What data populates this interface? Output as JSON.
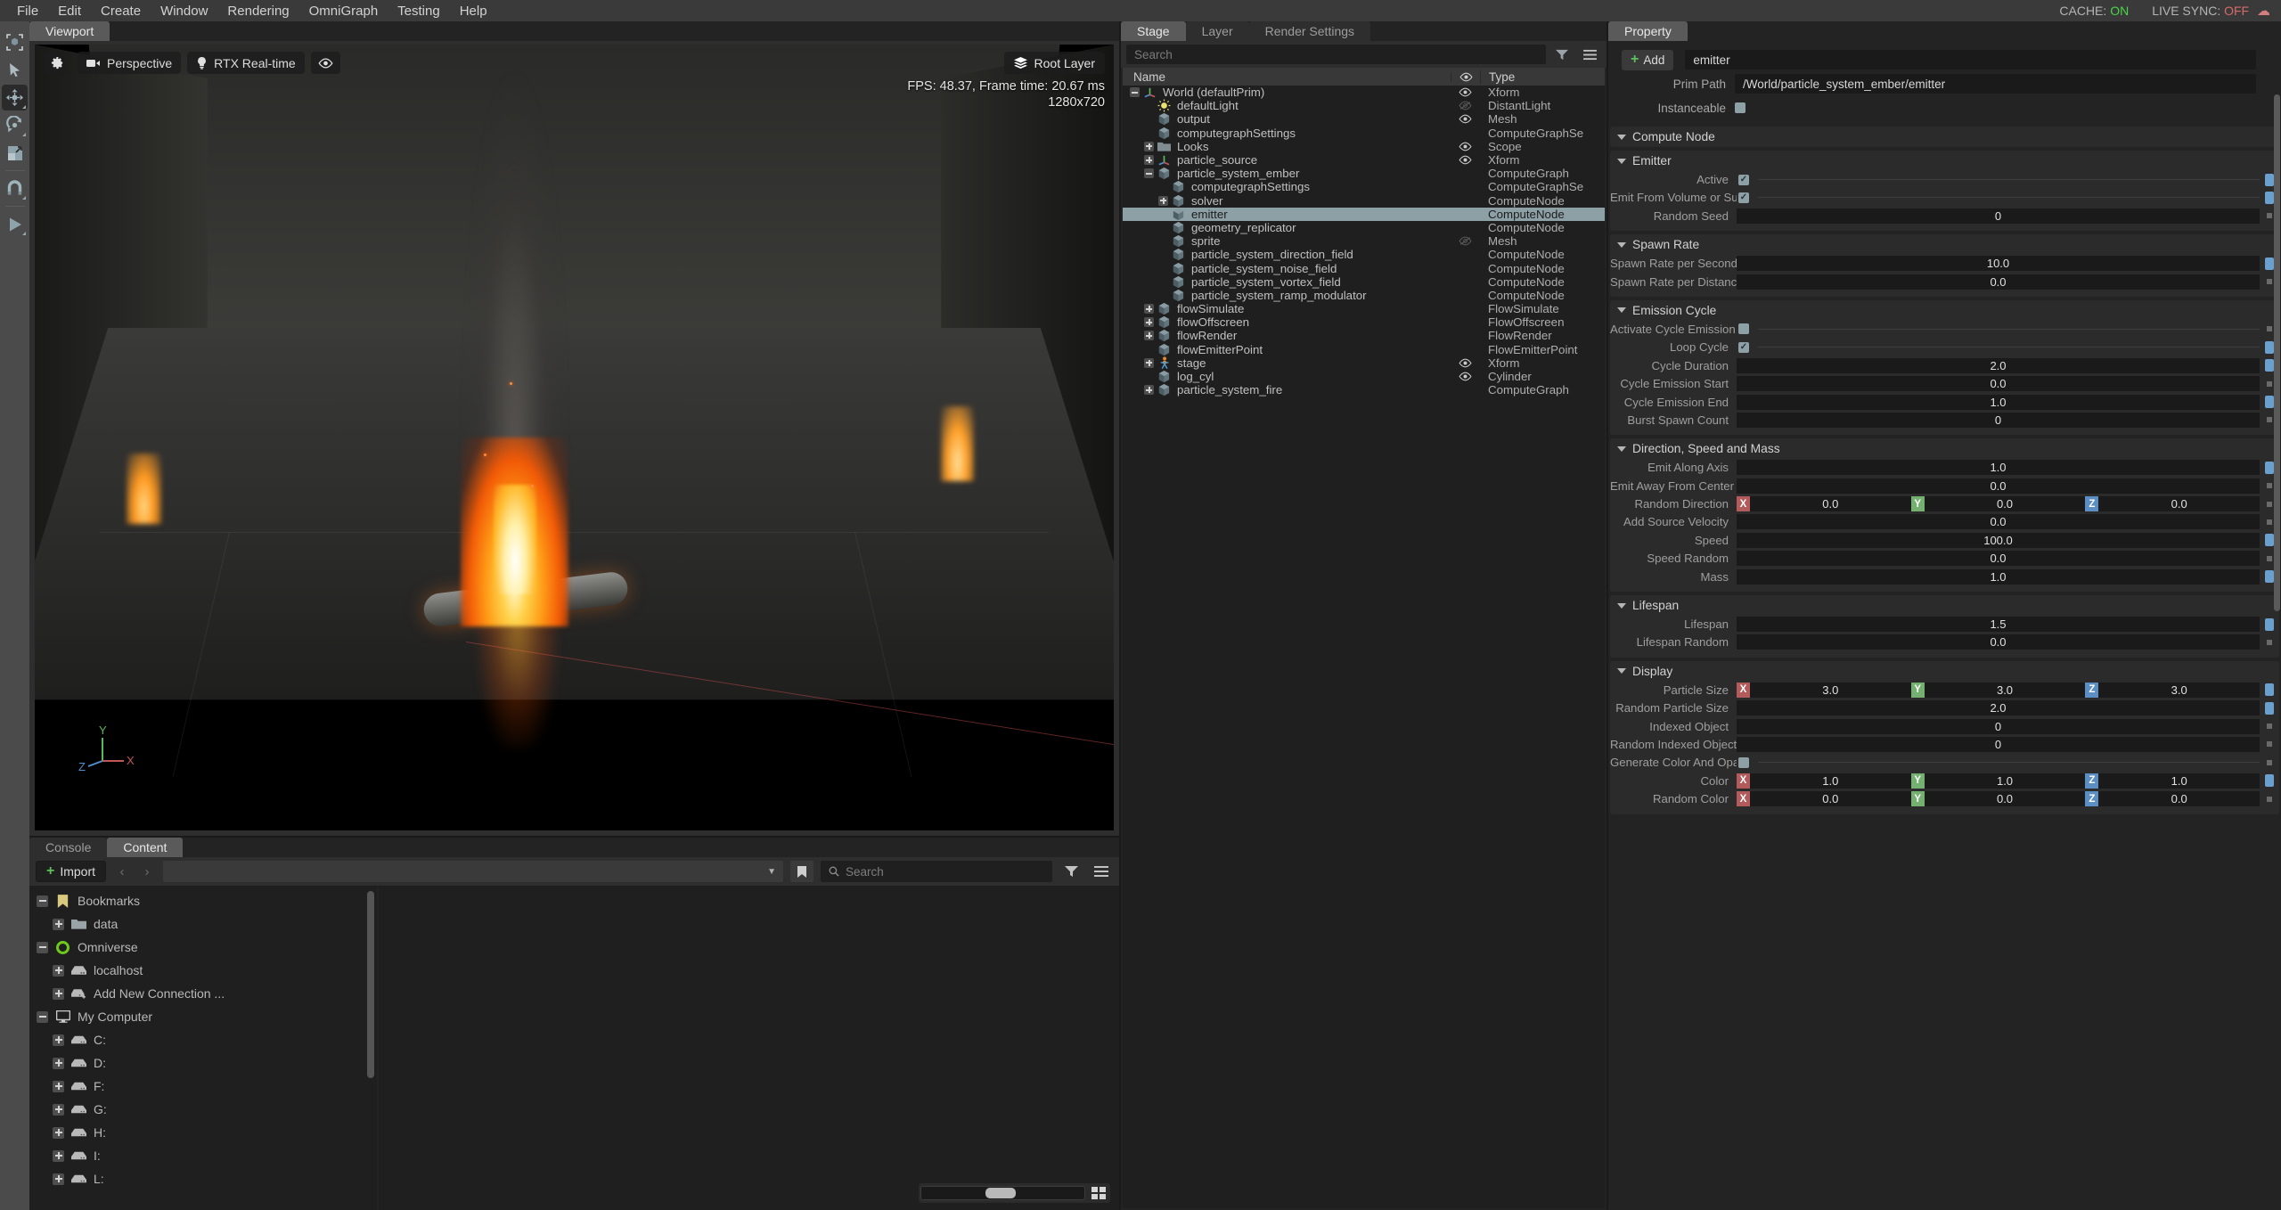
{
  "menu": {
    "items": [
      "File",
      "Edit",
      "Create",
      "Window",
      "Rendering",
      "OmniGraph",
      "Testing",
      "Help"
    ],
    "cache_label": "CACHE:",
    "cache_value": "ON",
    "livesync_label": "LIVE SYNC:",
    "livesync_value": "OFF"
  },
  "viewport": {
    "tab": "Viewport",
    "settings_button": "settings",
    "camera_label": "Perspective",
    "renderer_label": "RTX Real-time",
    "visibility_button": "visibility",
    "root_layer": "Root Layer",
    "fps_text": "FPS: 48.37, Frame time: 20.67 ms",
    "resolution": "1280x720",
    "axis": {
      "x": "X",
      "y": "Y",
      "z": "Z"
    }
  },
  "toolbar": {
    "tools": [
      {
        "name": "select-box-tool",
        "label": "Select Box",
        "active": false
      },
      {
        "name": "select-tool",
        "label": "Select",
        "active": false
      },
      {
        "name": "move-tool",
        "label": "Move",
        "active": true
      },
      {
        "name": "rotate-tool",
        "label": "Rotate",
        "active": false
      },
      {
        "name": "scale-tool",
        "label": "Scale",
        "active": false
      },
      {
        "name": "snap-tool",
        "label": "Snap",
        "active": false
      },
      {
        "name": "play-tool",
        "label": "Play",
        "active": false
      }
    ]
  },
  "bottom": {
    "tabs": [
      {
        "label": "Console",
        "active": false
      },
      {
        "label": "Content",
        "active": true
      }
    ],
    "import_label": "Import",
    "path_value": "",
    "search_placeholder": "Search",
    "tree": [
      {
        "label": "Bookmarks",
        "indent": 0,
        "expander": "minus",
        "icon": "bookmark-icon"
      },
      {
        "label": "data",
        "indent": 1,
        "expander": "plus",
        "icon": "folder-icon"
      },
      {
        "label": "Omniverse",
        "indent": 0,
        "expander": "minus",
        "icon": "omniverse-icon"
      },
      {
        "label": "localhost",
        "indent": 1,
        "expander": "plus",
        "icon": "server-icon"
      },
      {
        "label": "Add New Connection ...",
        "indent": 1,
        "expander": "plus",
        "icon": "server-add-icon"
      },
      {
        "label": "My Computer",
        "indent": 0,
        "expander": "minus",
        "icon": "computer-icon"
      },
      {
        "label": "C:",
        "indent": 1,
        "expander": "plus",
        "icon": "drive-icon"
      },
      {
        "label": "D:",
        "indent": 1,
        "expander": "plus",
        "icon": "drive-icon"
      },
      {
        "label": "F:",
        "indent": 1,
        "expander": "plus",
        "icon": "drive-icon"
      },
      {
        "label": "G:",
        "indent": 1,
        "expander": "plus",
        "icon": "drive-icon"
      },
      {
        "label": "H:",
        "indent": 1,
        "expander": "plus",
        "icon": "drive-icon"
      },
      {
        "label": "I:",
        "indent": 1,
        "expander": "plus",
        "icon": "drive-icon"
      },
      {
        "label": "L:",
        "indent": 1,
        "expander": "plus",
        "icon": "drive-icon"
      }
    ]
  },
  "stage": {
    "tabs": [
      {
        "label": "Stage",
        "active": true
      },
      {
        "label": "Layer",
        "active": false
      },
      {
        "label": "Render Settings",
        "active": false
      }
    ],
    "search_placeholder": "Search",
    "columns": {
      "name": "Name",
      "type": "Type"
    },
    "rows": [
      {
        "label": "World (defaultPrim)",
        "type": "Xform",
        "indent": 0,
        "expander": "minus",
        "icon": "axis-icon",
        "eye": "visible",
        "selected": false
      },
      {
        "label": "defaultLight",
        "type": "DistantLight",
        "indent": 1,
        "expander": "none",
        "icon": "light-icon",
        "eye": "hidden",
        "selected": false
      },
      {
        "label": "output",
        "type": "Mesh",
        "indent": 1,
        "expander": "none",
        "icon": "cube-icon",
        "eye": "visible",
        "selected": false
      },
      {
        "label": "computegraphSettings",
        "type": "ComputeGraphSe",
        "indent": 1,
        "expander": "none",
        "icon": "cube-icon",
        "eye": "none",
        "selected": false
      },
      {
        "label": "Looks",
        "type": "Scope",
        "indent": 1,
        "expander": "plus",
        "icon": "folder-icon",
        "eye": "visible",
        "selected": false
      },
      {
        "label": "particle_source",
        "type": "Xform",
        "indent": 1,
        "expander": "plus",
        "icon": "axis-icon",
        "eye": "visible",
        "selected": false
      },
      {
        "label": "particle_system_ember",
        "type": "ComputeGraph",
        "indent": 1,
        "expander": "minus",
        "icon": "cube-icon",
        "eye": "none",
        "selected": false
      },
      {
        "label": "computegraphSettings",
        "type": "ComputeGraphSe",
        "indent": 2,
        "expander": "none",
        "icon": "cube-icon",
        "eye": "none",
        "selected": false
      },
      {
        "label": "solver",
        "type": "ComputeNode",
        "indent": 2,
        "expander": "plus",
        "icon": "cube-icon",
        "eye": "none",
        "selected": false
      },
      {
        "label": "emitter",
        "type": "ComputeNode",
        "indent": 2,
        "expander": "none",
        "icon": "cube-icon",
        "eye": "none",
        "selected": true
      },
      {
        "label": "geometry_replicator",
        "type": "ComputeNode",
        "indent": 2,
        "expander": "none",
        "icon": "cube-icon",
        "eye": "none",
        "selected": false
      },
      {
        "label": "sprite",
        "type": "Mesh",
        "indent": 2,
        "expander": "none",
        "icon": "cube-icon",
        "eye": "hidden",
        "selected": false
      },
      {
        "label": "particle_system_direction_field",
        "type": "ComputeNode",
        "indent": 2,
        "expander": "none",
        "icon": "cube-icon",
        "eye": "none",
        "selected": false
      },
      {
        "label": "particle_system_noise_field",
        "type": "ComputeNode",
        "indent": 2,
        "expander": "none",
        "icon": "cube-icon",
        "eye": "none",
        "selected": false
      },
      {
        "label": "particle_system_vortex_field",
        "type": "ComputeNode",
        "indent": 2,
        "expander": "none",
        "icon": "cube-icon",
        "eye": "none",
        "selected": false
      },
      {
        "label": "particle_system_ramp_modulator",
        "type": "ComputeNode",
        "indent": 2,
        "expander": "none",
        "icon": "cube-icon",
        "eye": "none",
        "selected": false
      },
      {
        "label": "flowSimulate",
        "type": "FlowSimulate",
        "indent": 1,
        "expander": "plus",
        "icon": "cube-icon",
        "eye": "none",
        "selected": false
      },
      {
        "label": "flowOffscreen",
        "type": "FlowOffscreen",
        "indent": 1,
        "expander": "plus",
        "icon": "cube-icon",
        "eye": "none",
        "selected": false
      },
      {
        "label": "flowRender",
        "type": "FlowRender",
        "indent": 1,
        "expander": "plus",
        "icon": "cube-icon",
        "eye": "none",
        "selected": false
      },
      {
        "label": "flowEmitterPoint",
        "type": "FlowEmitterPoint",
        "indent": 1,
        "expander": "none",
        "icon": "cube-icon",
        "eye": "none",
        "selected": false
      },
      {
        "label": "stage",
        "type": "Xform",
        "indent": 1,
        "expander": "plus",
        "icon": "person-icon",
        "eye": "visible",
        "selected": false
      },
      {
        "label": "log_cyl",
        "type": "Cylinder",
        "indent": 1,
        "expander": "none",
        "icon": "cube-icon",
        "eye": "visible",
        "selected": false
      },
      {
        "label": "particle_system_fire",
        "type": "ComputeGraph",
        "indent": 1,
        "expander": "plus",
        "icon": "cube-icon",
        "eye": "none",
        "selected": false
      }
    ]
  },
  "property": {
    "tab": "Property",
    "add_label": "Add",
    "prim_name": "emitter",
    "prim_path_label": "Prim Path",
    "prim_path": "/World/particle_system_ember/emitter",
    "instanceable_label": "Instanceable",
    "instanceable_checked": false,
    "compute_node_header": "Compute Node",
    "sections": [
      {
        "title": "Emitter",
        "attrs": [
          {
            "label": "Active",
            "kind": "bool",
            "value": true,
            "end": "blue"
          },
          {
            "label": "Emit From Volume or Surface",
            "kind": "bool",
            "value": true,
            "end": "blue"
          },
          {
            "label": "Random Seed",
            "kind": "num",
            "value": "0",
            "end": "grey"
          }
        ]
      },
      {
        "title": "Spawn Rate",
        "attrs": [
          {
            "label": "Spawn Rate per Second",
            "kind": "num",
            "value": "10.0",
            "end": "blue"
          },
          {
            "label": "Spawn Rate per Distance",
            "kind": "num",
            "value": "0.0",
            "end": "grey"
          }
        ]
      },
      {
        "title": "Emission Cycle",
        "attrs": [
          {
            "label": "Activate Cycle Emission",
            "kind": "bool",
            "value": false,
            "end": "grey"
          },
          {
            "label": "Loop Cycle",
            "kind": "bool",
            "value": true,
            "end": "blue"
          },
          {
            "label": "Cycle Duration",
            "kind": "num",
            "value": "2.0",
            "end": "blue"
          },
          {
            "label": "Cycle Emission Start",
            "kind": "num",
            "value": "0.0",
            "end": "grey"
          },
          {
            "label": "Cycle Emission End",
            "kind": "num",
            "value": "1.0",
            "end": "blue"
          },
          {
            "label": "Burst Spawn Count",
            "kind": "num",
            "value": "0",
            "end": "grey"
          }
        ]
      },
      {
        "title": "Direction, Speed and Mass",
        "attrs": [
          {
            "label": "Emit Along Axis",
            "kind": "num",
            "value": "1.0",
            "end": "blue"
          },
          {
            "label": "Emit Away From Center",
            "kind": "num",
            "value": "0.0",
            "end": "grey"
          },
          {
            "label": "Random Direction",
            "kind": "xyz",
            "x": "0.0",
            "y": "0.0",
            "z": "0.0",
            "end": "grey"
          },
          {
            "label": "Add Source Velocity",
            "kind": "num",
            "value": "0.0",
            "end": "grey"
          },
          {
            "label": "Speed",
            "kind": "num",
            "value": "100.0",
            "end": "blue"
          },
          {
            "label": "Speed Random",
            "kind": "num",
            "value": "0.0",
            "end": "grey"
          },
          {
            "label": "Mass",
            "kind": "num",
            "value": "1.0",
            "end": "blue"
          }
        ]
      },
      {
        "title": "Lifespan",
        "attrs": [
          {
            "label": "Lifespan",
            "kind": "num",
            "value": "1.5",
            "end": "blue"
          },
          {
            "label": "Lifespan Random",
            "kind": "num",
            "value": "0.0",
            "end": "grey"
          }
        ]
      },
      {
        "title": "Display",
        "attrs": [
          {
            "label": "Particle Size",
            "kind": "xyz",
            "x": "3.0",
            "y": "3.0",
            "z": "3.0",
            "end": "blue"
          },
          {
            "label": "Random Particle Size",
            "kind": "num",
            "value": "2.0",
            "end": "blue"
          },
          {
            "label": "Indexed Object",
            "kind": "num",
            "value": "0",
            "end": "grey"
          },
          {
            "label": "Random Indexed Object",
            "kind": "num",
            "value": "0",
            "end": "grey"
          },
          {
            "label": "Generate Color And Opacity",
            "kind": "bool",
            "value": false,
            "end": "grey"
          },
          {
            "label": "Color",
            "kind": "xyz",
            "x": "1.0",
            "y": "1.0",
            "z": "1.0",
            "end": "blue"
          },
          {
            "label": "Random Color",
            "kind": "xyz",
            "x": "0.0",
            "y": "0.0",
            "z": "0.0",
            "end": "grey"
          }
        ]
      }
    ]
  },
  "colors": {
    "accent_blue": "#6a9fce",
    "axis_x": "#b35b5b",
    "axis_y": "#74b06f",
    "axis_z": "#5b8fc4",
    "green_on": "#49d649",
    "red_off": "#d66b6b",
    "selection": "#8ca0a6"
  }
}
